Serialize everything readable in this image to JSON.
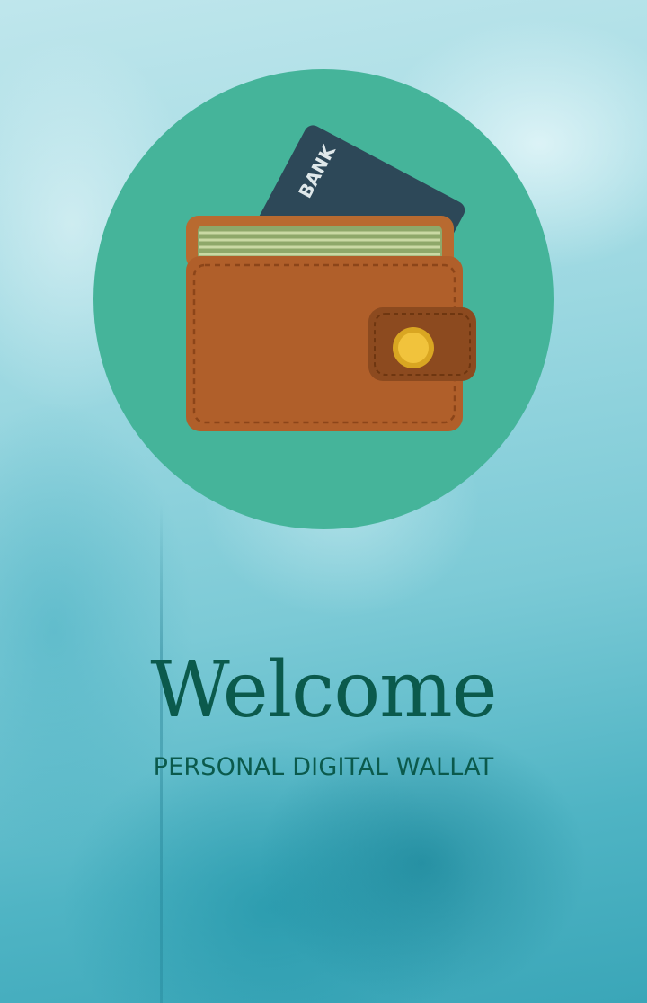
{
  "welcome": {
    "title": "Welcome",
    "subtitle": "PERSONAL DIGITAL WALLAT"
  },
  "logo": {
    "icon": "wallet-icon",
    "card_text": "BANK",
    "colors": {
      "circle": "#45b49a",
      "wallet": "#b05f2a",
      "card": "#2d4858",
      "button": "#f1c33c"
    }
  },
  "background": {
    "style": "watercolor texture",
    "colors": [
      "#bfe6ec",
      "#7ccad6",
      "#3aa6b8"
    ]
  }
}
